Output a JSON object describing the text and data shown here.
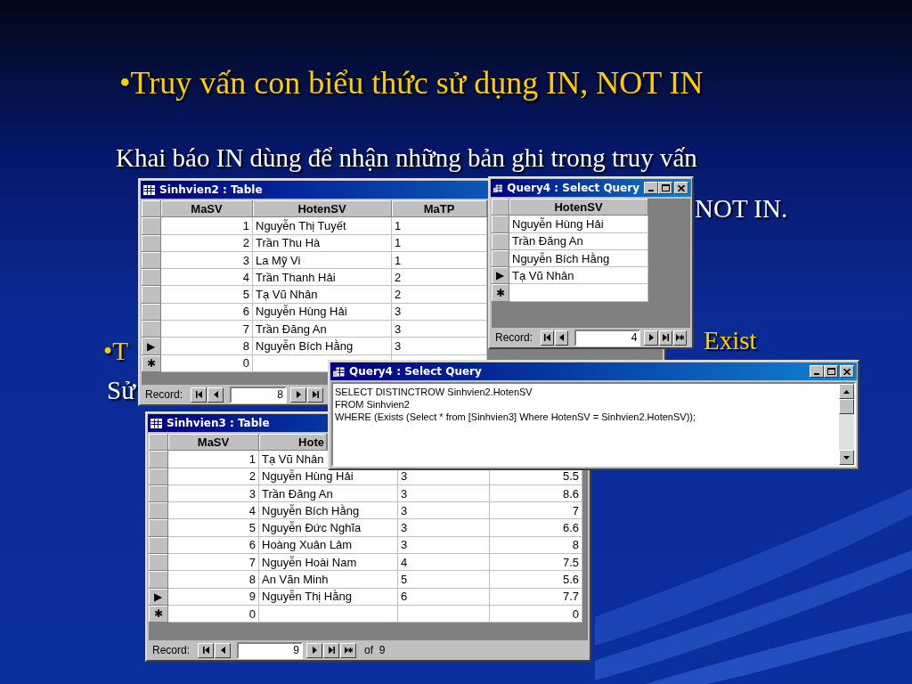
{
  "slide": {
    "title": "•Truy vấn con biểu thức sử dụng IN, NOT IN",
    "texts": [
      {
        "text": "Khai báo IN dùng để nhận những bản ghi trong truy vấn",
        "kind": "body"
      },
      {
        "text": "NOT IN.",
        "kind": "body"
      },
      {
        "text": "•T",
        "kind": "bullet"
      },
      {
        "text": "Exist",
        "kind": "bullet"
      },
      {
        "text": "Sử",
        "kind": "body"
      }
    ]
  },
  "table_window_1": {
    "title": "Sinhvien2 : Table",
    "columns": [
      "MaSV",
      "HotenSV",
      "MaTP"
    ],
    "rows": [
      {
        "marker": null,
        "cells": [
          "1",
          "Nguyễn Thị Tuyết",
          "1"
        ]
      },
      {
        "marker": null,
        "cells": [
          "2",
          "Trần Thu Hà",
          "1"
        ]
      },
      {
        "marker": null,
        "cells": [
          "3",
          "La Mỹ Vi",
          "1"
        ]
      },
      {
        "marker": null,
        "cells": [
          "4",
          "Trần Thanh Hải",
          "2"
        ]
      },
      {
        "marker": null,
        "cells": [
          "5",
          "Tạ Vũ Nhân",
          "2"
        ]
      },
      {
        "marker": null,
        "cells": [
          "6",
          "Nguyễn Hùng Hải",
          "3"
        ]
      },
      {
        "marker": null,
        "cells": [
          "7",
          "Trần Đăng An",
          "3"
        ]
      },
      {
        "marker": "▶",
        "cells": [
          "8",
          "Nguyễn Bích Hằng",
          "3"
        ]
      },
      {
        "marker": "✱",
        "cells": [
          "0",
          null,
          null
        ]
      }
    ],
    "record_label": "Record:",
    "record_value": "8"
  },
  "query_window_1": {
    "title": "Query4 : Select Query",
    "columns": [
      "HotenSV"
    ],
    "rows": [
      {
        "marker": null,
        "cells": [
          "Nguyễn Hùng Hải"
        ]
      },
      {
        "marker": null,
        "cells": [
          "Trần Đăng An"
        ]
      },
      {
        "marker": null,
        "cells": [
          "Nguyễn Bích Hằng"
        ]
      },
      {
        "marker": "▶",
        "cells": [
          "Tạ Vũ Nhân"
        ]
      },
      {
        "marker": "✱",
        "cells": [
          null
        ]
      }
    ],
    "record_label": "Record:",
    "record_value": "4"
  },
  "table_window_2": {
    "title": "Sinhvien3 : Table",
    "columns": [
      "MaSV",
      "Hote",
      null,
      null
    ],
    "rows": [
      {
        "marker": null,
        "cells": [
          "1",
          "Tạ Vũ Nhân",
          null,
          null
        ]
      },
      {
        "marker": null,
        "cells": [
          "2",
          "Nguyễn Hùng Hải",
          "3",
          "5.5"
        ]
      },
      {
        "marker": null,
        "cells": [
          "3",
          "Trần Đăng An",
          "3",
          "8.6"
        ]
      },
      {
        "marker": null,
        "cells": [
          "4",
          "Nguyễn Bích Hằng",
          "3",
          "7"
        ]
      },
      {
        "marker": null,
        "cells": [
          "5",
          "Nguyễn Đức Nghĩa",
          "3",
          "6.6"
        ]
      },
      {
        "marker": null,
        "cells": [
          "6",
          "Hoàng Xuân Lâm",
          "3",
          "8"
        ]
      },
      {
        "marker": null,
        "cells": [
          "7",
          "Nguyễn Hoài Nam",
          "4",
          "7.5"
        ]
      },
      {
        "marker": null,
        "cells": [
          "8",
          "An Văn Minh",
          "5",
          "5.6"
        ]
      },
      {
        "marker": "▶",
        "cells": [
          "9",
          "Nguyễn Thị Hằng",
          "6",
          "7.7"
        ]
      },
      {
        "marker": "✱",
        "cells": [
          "0",
          null,
          null,
          "0"
        ]
      }
    ],
    "record_label": "Record:",
    "record_value": "9",
    "record_count": "of  9"
  },
  "query_window_2": {
    "title": "Query4 : Select Query",
    "sql_lines": [
      "SELECT DISTINCTROW Sinhvien2.HotenSV",
      "FROM Sinhvien2",
      "WHERE (Exists (Select * from [Sinhvien3] Where HotenSV = Sinhvien2.HotenSV));"
    ]
  }
}
